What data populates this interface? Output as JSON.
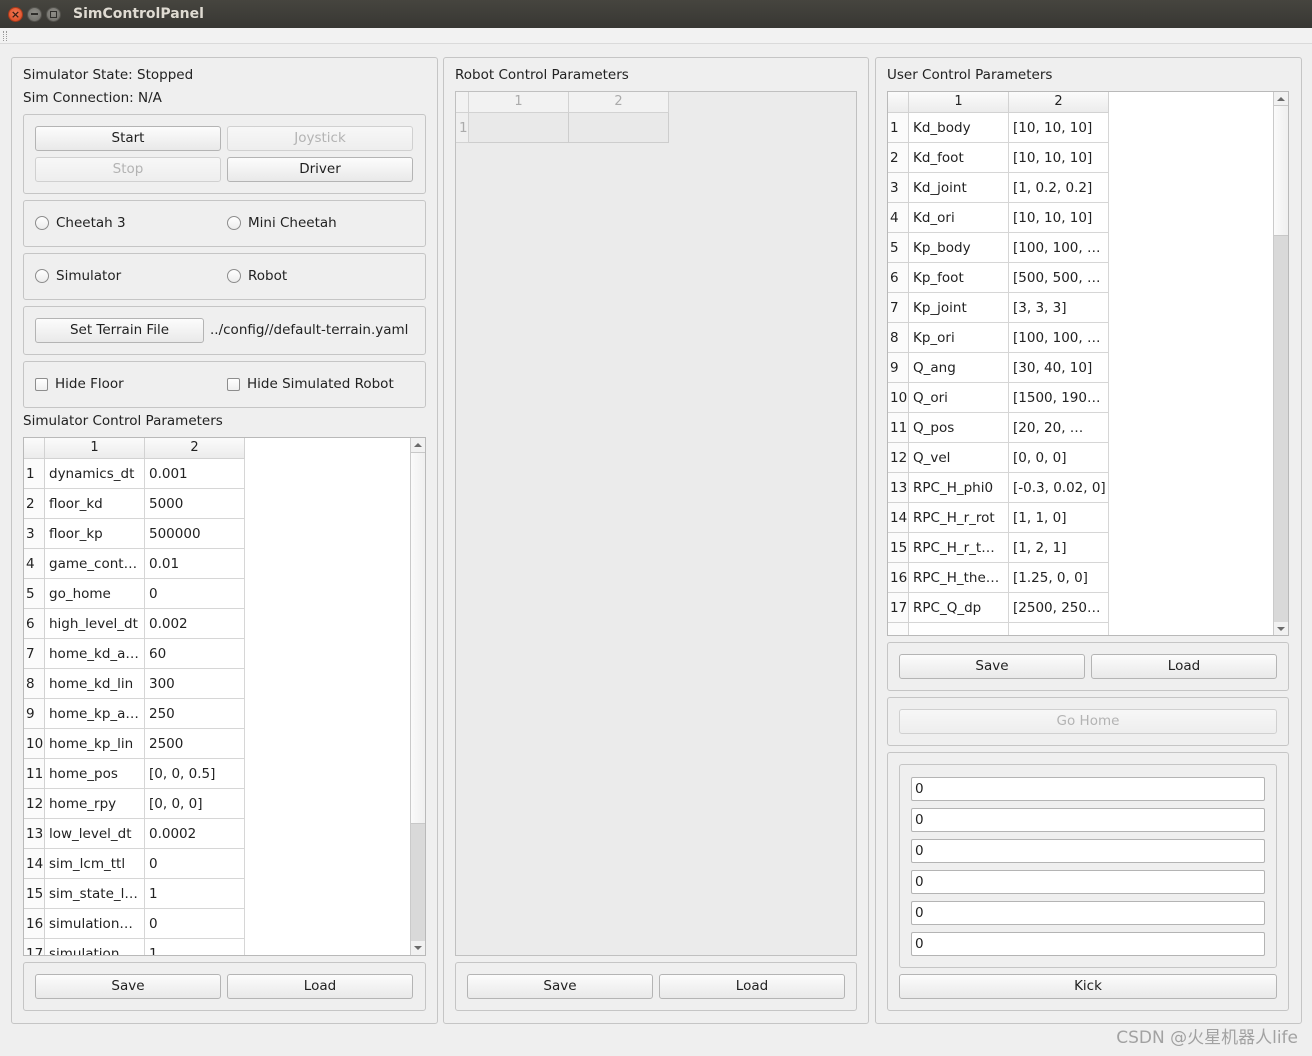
{
  "window": {
    "title": "SimControlPanel"
  },
  "simulator_panel": {
    "state_label": "Simulator State: Stopped",
    "connection_label": "Sim Connection: N/A",
    "buttons": {
      "start": {
        "label": "Start",
        "enabled": true
      },
      "joystick": {
        "label": "Joystick",
        "enabled": false
      },
      "stop": {
        "label": "Stop",
        "enabled": false
      },
      "driver": {
        "label": "Driver",
        "enabled": true
      }
    },
    "robot_type_options": [
      {
        "label": "Cheetah 3",
        "checked": false
      },
      {
        "label": "Mini Cheetah",
        "checked": false
      }
    ],
    "run_mode_options": [
      {
        "label": "Simulator",
        "checked": false
      },
      {
        "label": "Robot",
        "checked": false
      }
    ],
    "terrain": {
      "button_label": "Set Terrain File",
      "file_path": "../config//default-terrain.yaml"
    },
    "display_options": [
      {
        "label": "Hide Floor",
        "checked": false
      },
      {
        "label": "Hide Simulated Robot",
        "checked": false
      }
    ],
    "parameters": {
      "title": "Simulator Control Parameters",
      "columns": [
        "1",
        "2"
      ],
      "rows": [
        {
          "index": "1",
          "name": "dynamics_dt",
          "value": "0.001"
        },
        {
          "index": "2",
          "name": "floor_kd",
          "value": "5000"
        },
        {
          "index": "3",
          "name": "floor_kp",
          "value": "500000"
        },
        {
          "index": "4",
          "name": "game_cont…",
          "value": "0.01"
        },
        {
          "index": "5",
          "name": "go_home",
          "value": "0"
        },
        {
          "index": "6",
          "name": "high_level_dt",
          "value": "0.002"
        },
        {
          "index": "7",
          "name": "home_kd_a…",
          "value": "60"
        },
        {
          "index": "8",
          "name": "home_kd_lin",
          "value": "300"
        },
        {
          "index": "9",
          "name": "home_kp_a…",
          "value": "250"
        },
        {
          "index": "10",
          "name": "home_kp_lin",
          "value": "2500"
        },
        {
          "index": "11",
          "name": "home_pos",
          "value": "[0, 0, 0.5]"
        },
        {
          "index": "12",
          "name": "home_rpy",
          "value": "[0, 0, 0]"
        },
        {
          "index": "13",
          "name": "low_level_dt",
          "value": "0.0002"
        },
        {
          "index": "14",
          "name": "sim_lcm_ttl",
          "value": "0"
        },
        {
          "index": "15",
          "name": "sim_state_l…",
          "value": "1"
        },
        {
          "index": "16",
          "name": "simulation…",
          "value": "0"
        },
        {
          "index": "17",
          "name": "simulation…",
          "value": "1"
        }
      ]
    },
    "save_label": "Save",
    "load_label": "Load"
  },
  "robot_panel": {
    "parameters": {
      "title": "Robot Control Parameters",
      "enabled": false,
      "columns": [
        "1",
        "2"
      ],
      "rows": [
        {
          "index": "1",
          "name": "",
          "value": ""
        }
      ]
    },
    "save_label": "Save",
    "load_label": "Load"
  },
  "user_panel": {
    "parameters": {
      "title": "User Control Parameters",
      "columns": [
        "1",
        "2"
      ],
      "rows": [
        {
          "index": "1",
          "name": "Kd_body",
          "value": "[10, 10, 10]"
        },
        {
          "index": "2",
          "name": "Kd_foot",
          "value": "[10, 10, 10]"
        },
        {
          "index": "3",
          "name": "Kd_joint",
          "value": "[1, 0.2, 0.2]"
        },
        {
          "index": "4",
          "name": "Kd_ori",
          "value": "[10, 10, 10]"
        },
        {
          "index": "5",
          "name": "Kp_body",
          "value": "[100, 100, …"
        },
        {
          "index": "6",
          "name": "Kp_foot",
          "value": "[500, 500, …"
        },
        {
          "index": "7",
          "name": "Kp_joint",
          "value": "[3, 3, 3]"
        },
        {
          "index": "8",
          "name": "Kp_ori",
          "value": "[100, 100, …"
        },
        {
          "index": "9",
          "name": "Q_ang",
          "value": "[30, 40, 10]"
        },
        {
          "index": "10",
          "name": "Q_ori",
          "value": "[1500, 190…"
        },
        {
          "index": "11",
          "name": "Q_pos",
          "value": "[20, 20, …"
        },
        {
          "index": "12",
          "name": "Q_vel",
          "value": "[0, 0, 0]"
        },
        {
          "index": "13",
          "name": "RPC_H_phi0",
          "value": "[-0.3, 0.02, 0]"
        },
        {
          "index": "14",
          "name": "RPC_H_r_rot",
          "value": "[1, 1, 0]"
        },
        {
          "index": "15",
          "name": "RPC_H_r_t…",
          "value": "[1, 2, 1]"
        },
        {
          "index": "16",
          "name": "RPC_H_the…",
          "value": "[1.25, 0, 0]"
        },
        {
          "index": "17",
          "name": "RPC_Q_dp",
          "value": "[2500, 250…"
        }
      ]
    },
    "save_label": "Save",
    "load_label": "Load",
    "go_home": {
      "label": "Go Home",
      "enabled": false
    },
    "inputs": [
      "0",
      "0",
      "0",
      "0",
      "0",
      "0"
    ],
    "kick_label": "Kick"
  },
  "watermark": "CSDN @火星机器人life"
}
